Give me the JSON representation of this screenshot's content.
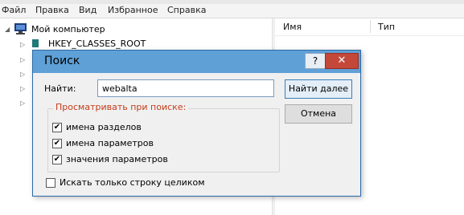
{
  "menu": {
    "items": [
      "Файл",
      "Правка",
      "Вид",
      "Избранное",
      "Справка"
    ]
  },
  "tree": {
    "root_label": "Мой компьютер",
    "first_child": "HKEY_CLASSES_ROOT"
  },
  "list": {
    "columns": [
      "Имя",
      "Тип"
    ]
  },
  "dialog": {
    "title": "Поиск",
    "help_symbol": "?",
    "close_symbol": "✕",
    "find_label": "Найти:",
    "find_value": "webalta",
    "find_next_label": "Найти далее",
    "cancel_label": "Отмена",
    "group_title": "Просматривать при поиске:",
    "options": [
      {
        "label": "имена разделов",
        "checked": true
      },
      {
        "label": "имена параметров",
        "checked": true
      },
      {
        "label": "значения параметров",
        "checked": true
      }
    ],
    "whole_string": {
      "label": "Искать только строку целиком",
      "checked": false
    }
  },
  "colors": {
    "title_bar": "#5fa0d7",
    "close_button": "#c4483a",
    "group_title": "#c43d1a",
    "folder_icon": "#1f7a78"
  }
}
